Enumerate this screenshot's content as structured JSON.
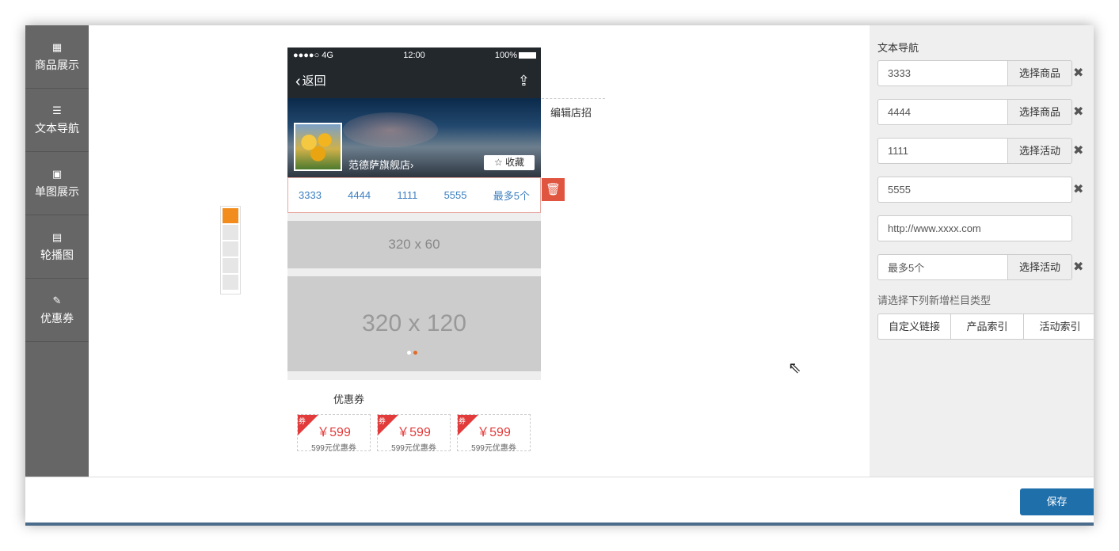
{
  "sidebar": {
    "items": [
      {
        "label": "商品展示",
        "icon": "▦"
      },
      {
        "label": "文本导航",
        "icon": "☰"
      },
      {
        "label": "单图展示",
        "icon": "▣"
      },
      {
        "label": "轮播图",
        "icon": "▤"
      },
      {
        "label": "优惠券",
        "icon": "✎"
      }
    ]
  },
  "phone": {
    "status": {
      "signal": "●●●●○ 4G",
      "time": "12:00",
      "battery": "100%"
    },
    "nav": {
      "back_label": "返回",
      "share_icon": "⇪"
    },
    "banner": {
      "store_name": "范德萨旗舰店›",
      "fav_label": "☆ 收藏"
    },
    "text_nav": [
      "3333",
      "4444",
      "1111",
      "5555",
      "最多5个"
    ],
    "placeholder_small": "320 x 60",
    "placeholder_large": "320 x 120",
    "delete_icon": "🗑"
  },
  "edit_store_label": "编辑店招",
  "coupon_section": {
    "title": "优惠券",
    "items": [
      {
        "tag": "券",
        "price": "￥599",
        "desc": "599元优惠券"
      },
      {
        "tag": "券",
        "price": "￥599",
        "desc": "599元优惠券"
      },
      {
        "tag": "券",
        "price": "￥599",
        "desc": "599元优惠券"
      }
    ]
  },
  "panel": {
    "title": "文本导航",
    "rows": [
      {
        "value": "3333",
        "button": "选择商品"
      },
      {
        "value": "4444",
        "button": "选择商品"
      },
      {
        "value": "1111",
        "button": "选择活动"
      },
      {
        "value": "5555"
      },
      {
        "value": "http://www.xxxx.com"
      },
      {
        "value": "最多5个",
        "button": "选择活动"
      }
    ],
    "remove_icon": "✖",
    "hint": "请选择下列新增栏目类型",
    "type_buttons": [
      "自定义链接",
      "产品索引",
      "活动索引"
    ]
  },
  "footer": {
    "save_label": "保存"
  },
  "colors": {
    "sidebar": "#666666",
    "active_tab": "#f28c1c",
    "link": "#3c7fc0",
    "danger": "#e05540",
    "primary": "#1f6fab",
    "coupon": "#e23b3b"
  }
}
